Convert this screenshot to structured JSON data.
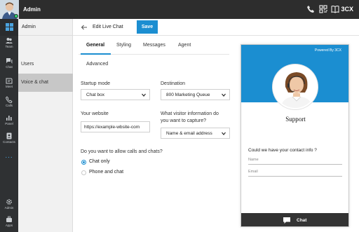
{
  "topbar": {
    "user_name": "Admin",
    "logo_text": "3CX",
    "icons": [
      "phone-icon",
      "qr-code-icon",
      "book-icon",
      "chat-bubble-icon"
    ],
    "status_color": "#2ecc71"
  },
  "rail": {
    "items": [
      {
        "label": "",
        "icon": "windows-icon"
      },
      {
        "label": "Team",
        "icon": "team-icon"
      },
      {
        "label": "Chat",
        "icon": "chat-icon"
      },
      {
        "label": "Meet",
        "icon": "meet-icon"
      },
      {
        "label": "Calls",
        "icon": "calls-icon"
      },
      {
        "label": "Panel",
        "icon": "panel-icon"
      },
      {
        "label": "Contacts",
        "icon": "contacts-icon"
      }
    ],
    "more": "...",
    "bottom": [
      {
        "label": "Admin",
        "icon": "gear-icon"
      },
      {
        "label": "Apps",
        "icon": "apps-icon"
      }
    ]
  },
  "subnav": {
    "header": "Admin",
    "items": [
      {
        "label": "Users",
        "active": false
      },
      {
        "label": "Voice & chat",
        "active": true
      }
    ]
  },
  "header": {
    "title": "Edit Live Chat",
    "save_label": "Save"
  },
  "tabs": {
    "items": [
      "General",
      "Styling",
      "Messages",
      "Agent",
      "Advanced"
    ],
    "active": "General"
  },
  "form": {
    "startup_mode": {
      "label": "Startup mode",
      "value": "Chat box"
    },
    "destination": {
      "label": "Destination",
      "value": "800 Marketing Queue"
    },
    "website": {
      "label": "Your website",
      "value": "https://example-wbsite-com"
    },
    "visitor_info": {
      "label_line1": "What visitor information do",
      "label_line2": "you want to capture?",
      "value": "Name & email address"
    },
    "calls_question": "Do you want to allow calls and chats?",
    "options": [
      {
        "label": "Chat only",
        "selected": true
      },
      {
        "label": "Phone and chat",
        "selected": false
      }
    ]
  },
  "preview": {
    "powered_by": "Powered By 3CX",
    "title": "Support",
    "contact_question": "Could we have your contact info ?",
    "name_placeholder": "Name",
    "email_placeholder": "Email",
    "chat_label": "Chat",
    "accent_color": "#1b8ed1"
  },
  "colors": {
    "accent": "#1b8ed1",
    "topbar": "#2d2d2d",
    "rail": "#2f3133",
    "subnav": "#f1f1f1",
    "subnav_active": "#c7c7c7"
  }
}
